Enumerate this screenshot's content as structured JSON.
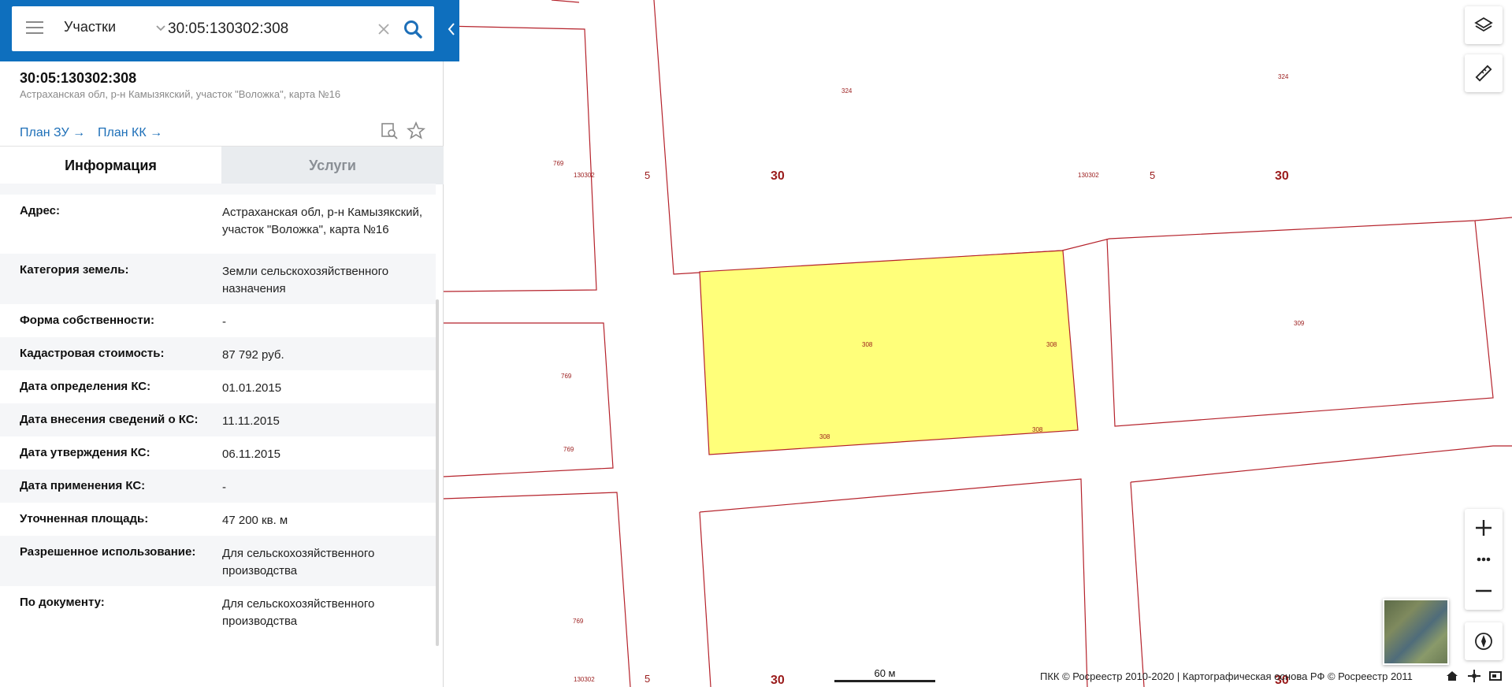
{
  "search": {
    "type_label": "Участки",
    "query": "30:05:130302:308"
  },
  "object": {
    "title": "30:05:130302:308",
    "address": "Астраханская обл, р-н Камызякский, участок \"Воложка\", карта №16",
    "plan_zu": "План ЗУ →",
    "plan_kk": "План КК →"
  },
  "tabs": [
    {
      "label": "Информация",
      "active": true
    },
    {
      "label": "Услуги",
      "active": false
    }
  ],
  "info_rows": [
    {
      "key": "Адрес:",
      "value": "Астраханская обл, р-н Камызякский, участок \"Воложка\", карта №16"
    },
    {
      "key": "Категория земель:",
      "value": "Земли сельскохозяйственного назначения"
    },
    {
      "key": "Форма собственности:",
      "value": "-"
    },
    {
      "key": "Кадастровая стоимость:",
      "value": "87 792 руб."
    },
    {
      "key": "Дата определения КС:",
      "value": "01.01.2015"
    },
    {
      "key": "Дата внесения сведений о КС:",
      "value": "11.11.2015"
    },
    {
      "key": "Дата утверждения КС:",
      "value": "06.11.2015"
    },
    {
      "key": "Дата применения КС:",
      "value": "-"
    },
    {
      "key": "Уточненная площадь:",
      "value": "47 200 кв. м"
    },
    {
      "key": "Разрешенное использование:",
      "value": "Для сельскохозяйственного производства"
    },
    {
      "key": "По документу:",
      "value": "Для сельскохозяйственного производства"
    }
  ],
  "map": {
    "labels_small": [
      "769",
      "130302",
      "324",
      "130302",
      "324",
      "309",
      "769",
      "769",
      "308",
      "308",
      "308",
      "308",
      "769",
      "130302"
    ],
    "labels_mid": [
      "5",
      "5",
      "5"
    ],
    "labels_big": [
      "30",
      "30",
      "30",
      "30"
    ],
    "scale_label": "60 м",
    "copyright": "ПКК © Росреестр 2010-2020 | Картографическая основа РФ © Росреестр 2011",
    "colors": {
      "parcel_border": "#b5222b",
      "selected_fill": "#ffff7a",
      "label": "#9a1b1b",
      "accent": "#0e6fbe"
    }
  },
  "controls": {
    "layers": "layers-icon",
    "ruler": "ruler-icon",
    "zoom_in": "plus-icon",
    "more": "dots-icon",
    "zoom_out": "minus-icon",
    "compass": "compass-icon"
  }
}
